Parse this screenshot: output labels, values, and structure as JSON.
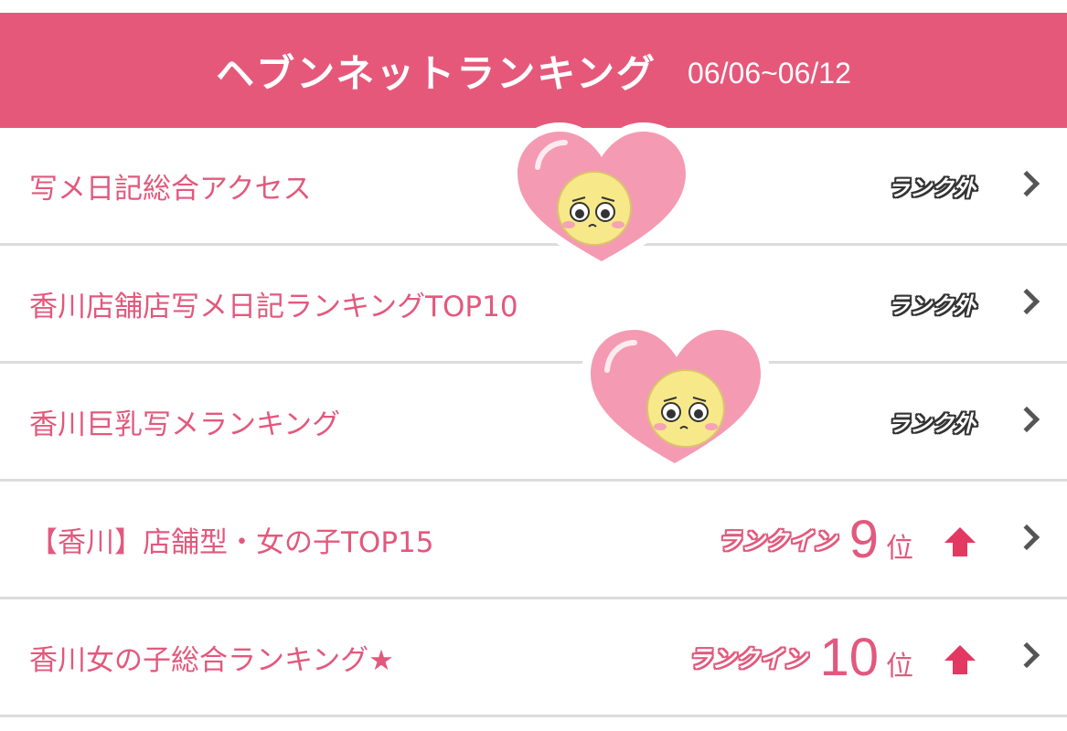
{
  "header": {
    "title": "ヘブンネットランキング",
    "period": "06/06~06/12",
    "color": "#e6587a"
  },
  "rows": [
    {
      "label": "写メ日記総合アクセス",
      "status": "ランク外"
    },
    {
      "label": "香川店舗店写メ日記ランキングTOP10",
      "status": "ランク外"
    },
    {
      "label": "香川巨乳写メランキング",
      "status": "ランク外"
    },
    {
      "label": "【香川】店舗型・女の子TOP15",
      "status": "ランクイン",
      "rank": "9",
      "suffix": "位",
      "trend": "up"
    },
    {
      "label": "香川女の子総合ランキング★",
      "status": "ランクイン",
      "rank": "10",
      "suffix": "位",
      "trend": "up"
    }
  ],
  "stickers": [
    {
      "name": "heart-face-sticker"
    },
    {
      "name": "heart-face-sticker"
    }
  ],
  "colors": {
    "accent": "#e2597d",
    "arrow_up": "#e33862",
    "chevron": "#555555"
  }
}
